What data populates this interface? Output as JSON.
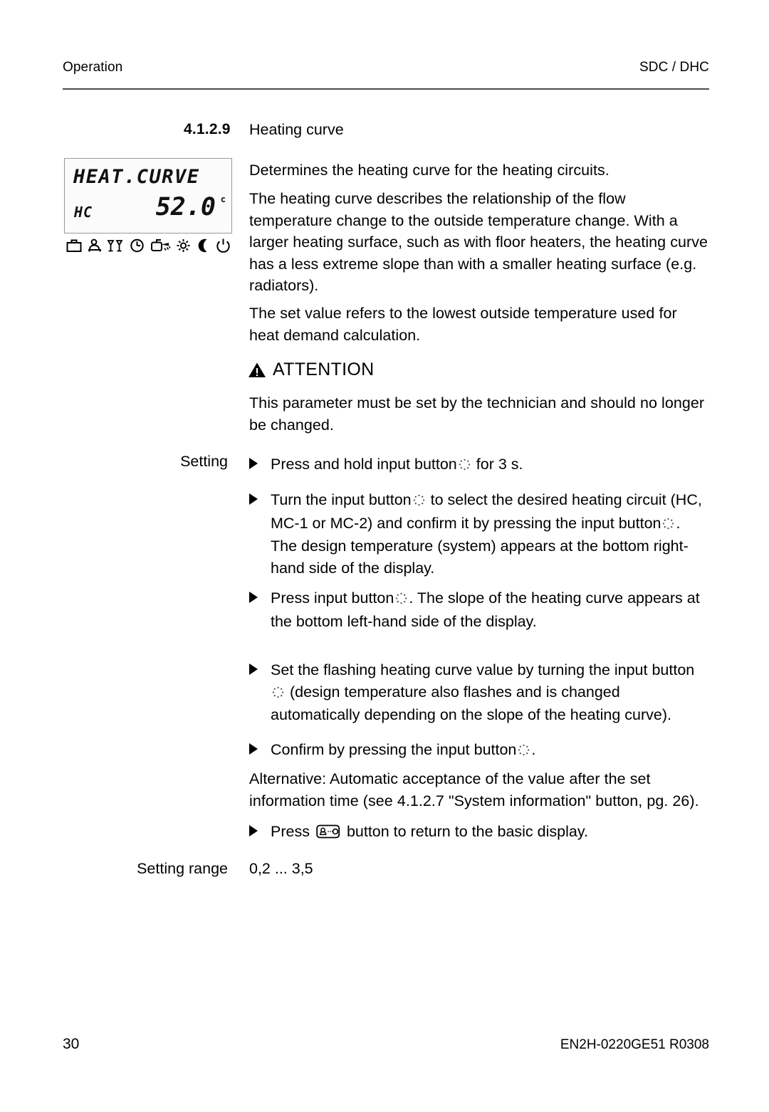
{
  "header": {
    "left": "Operation",
    "right": "SDC / DHC"
  },
  "section": {
    "number": "4.1.2.9",
    "title": "Heating curve"
  },
  "lcd": {
    "line1": "HEAT.CURVE",
    "circuit": "HC",
    "value": "52.0",
    "unit": "c",
    "icons": [
      "briefcase-icon",
      "bed-person-icon",
      "party-glasses-icon",
      "clock-icon",
      "faucet-water-icon",
      "sun-icon",
      "moon-icon",
      "standby-power-icon"
    ]
  },
  "body": {
    "p1": "Determines the heating curve for the heating circuits.",
    "p2": "The heating curve describes the relationship of the flow temperature change to the outside temperature change. With a larger heating surface, such as with floor heaters, the heating curve has a less extreme slope than with a smaller heating surface (e.g. radiators).",
    "p3": "The set value refers to the lowest outside temperature used for heat demand calculation.",
    "attention_label": "ATTENTION",
    "p4": "This parameter must be set by the technician and should no longer be changed.",
    "p5": "Alternative: Automatic acceptance of the value after the set information time (see 4.1.2.7 \"System information\" button, pg. 26)."
  },
  "setting": {
    "label": "Setting",
    "steps": [
      {
        "a": "Press and hold input button",
        "icon": "rotary-knob-icon",
        "b": "for 3 s."
      },
      {
        "a": "Turn the input button",
        "icon": "rotary-knob-icon",
        "b": "to select the desired heating circuit (HC, MC-1 or MC-2) and confirm it by pressing the input button",
        "icon2": "rotary-knob-icon",
        "c": ". The design temperature (system) appears at the bottom right-hand side of the display."
      },
      {
        "a": "Press input button",
        "icon": "rotary-knob-icon",
        "b": ". The slope of the heating curve appears at the bottom left-hand side of the display."
      },
      {
        "a": "Set the flashing heating curve value by turning the input button",
        "icon": "rotary-knob-icon",
        "b": "(design temperature also flashes and is changed automatically depending on the slope of the heating curve)."
      },
      {
        "a": "Confirm by pressing the input button",
        "icon": "rotary-knob-icon",
        "b": "."
      },
      {
        "a": "Press",
        "icon": "basic-display-key-icon",
        "b": "button to return to the basic display."
      }
    ]
  },
  "setting_range": {
    "label": "Setting range",
    "value": "0,2 ... 3,5"
  },
  "footer": {
    "page": "30",
    "doc_code": "EN2H-0220GE51 R0308"
  }
}
